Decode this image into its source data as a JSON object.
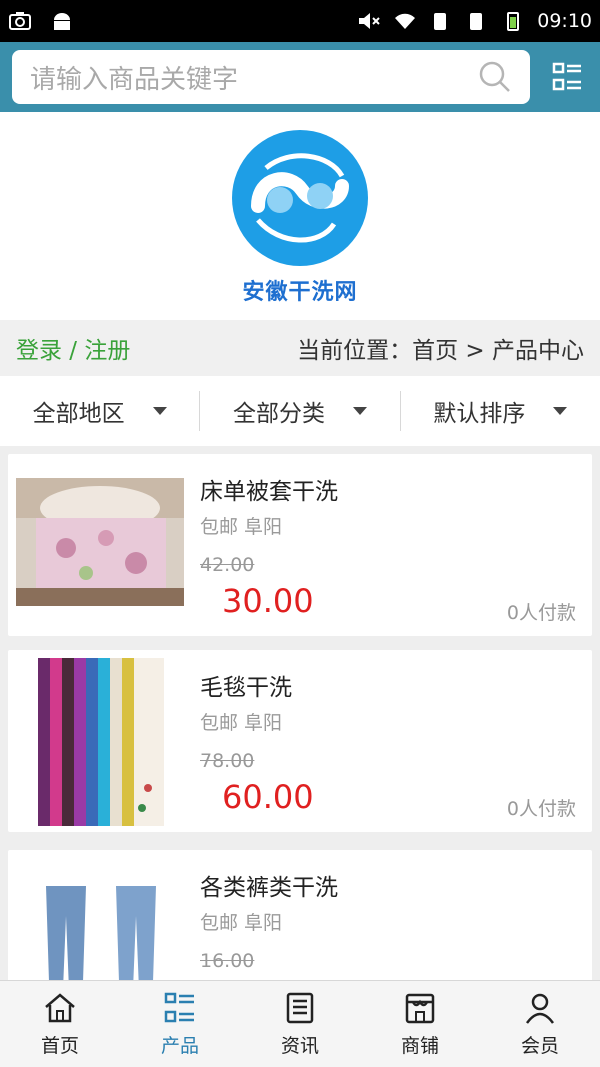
{
  "status_bar": {
    "time": "09:10"
  },
  "search": {
    "placeholder": "请输入商品关键字"
  },
  "brand": {
    "logo_text": "安徽干洗网"
  },
  "location": {
    "login": "登录 / 注册",
    "breadcrumb": "当前位置：首页 > 产品中心"
  },
  "filters": [
    "全部地区",
    "全部分类",
    "默认排序"
  ],
  "products": [
    {
      "title": "床单被套干洗",
      "meta": "包邮 阜阳",
      "old_price": "42.00",
      "price": "30.00",
      "paid": "0人付款"
    },
    {
      "title": "毛毯干洗",
      "meta": "包邮 阜阳",
      "old_price": "78.00",
      "price": "60.00",
      "paid": "0人付款"
    },
    {
      "title": "各类裤类干洗",
      "meta": "包邮 阜阳",
      "old_price": "16.00",
      "price": "",
      "paid": ""
    }
  ],
  "tabs": [
    {
      "label": "首页",
      "icon": "home-icon"
    },
    {
      "label": "产品",
      "icon": "grid-list-icon"
    },
    {
      "label": "资讯",
      "icon": "news-icon"
    },
    {
      "label": "商铺",
      "icon": "shop-icon"
    },
    {
      "label": "会员",
      "icon": "person-icon"
    }
  ],
  "colors": {
    "header": "#3a8fab",
    "price": "#e02020",
    "login": "#3aa23a",
    "active_tab": "#2a7fb0",
    "logo": "#1e9ee6"
  }
}
